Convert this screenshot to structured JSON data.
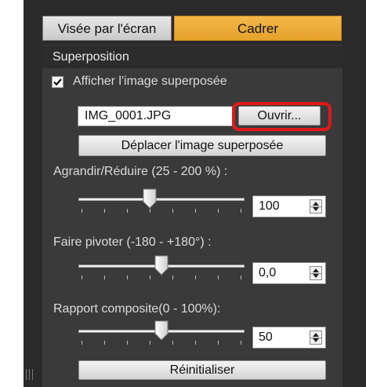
{
  "tabs": [
    {
      "label": "Visée par l'écran",
      "active": false
    },
    {
      "label": "Cadrer",
      "active": true
    }
  ],
  "section": {
    "title": "Superposition"
  },
  "overlay": {
    "checkbox_label": "Afficher l'image superposée",
    "checked": true,
    "filename": "IMG_0001.JPG",
    "open_button": "Ouvrir...",
    "move_button": "Déplacer l'image superposée"
  },
  "sliders": [
    {
      "label": "Agrandir/Réduire (25 - 200 %) :",
      "value": "100",
      "position": 0.4286
    },
    {
      "label": "Faire pivoter (-180 - +180°) :",
      "value": "0,0",
      "position": 0.5
    },
    {
      "label": "Rapport composite(0 - 100%):",
      "value": "50",
      "position": 0.5
    }
  ],
  "reset_button": "Réinitialiser",
  "colors": {
    "active_tab": "#f0ae3a",
    "highlight": "#e01919",
    "panel": "#3a3a3a"
  }
}
